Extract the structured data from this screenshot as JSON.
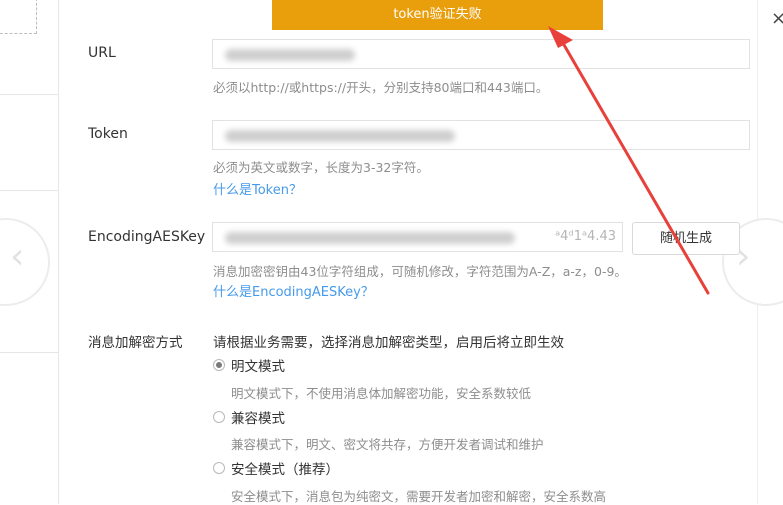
{
  "toast": {
    "message": "token验证失败"
  },
  "url_field": {
    "label": "URL",
    "hint": "必须以http://或https://开头，分别支持80端口和443端口。"
  },
  "token_field": {
    "label": "Token",
    "hint": "必须为英文或数字，长度为3-32字符。",
    "help_link": "什么是Token？"
  },
  "aes_field": {
    "label": "EncodingAESKey",
    "value_visible_suffix": "ᵃ4ᵈ1ᵃ4.43",
    "generate_button": "随机生成",
    "hint": "消息加密密钥由43位字符组成，可随机修改，字符范围为A-Z，a-z，0-9。",
    "help_link": "什么是EncodingAESKey？"
  },
  "encryption": {
    "label": "消息加解密方式",
    "intro": "请根据业务需要，选择消息加解密类型，启用后将立即生效",
    "options": [
      {
        "label": "明文模式",
        "desc": "明文模式下，不使用消息体加解密功能，安全系数较低",
        "checked": true
      },
      {
        "label": "兼容模式",
        "desc": "兼容模式下，明文、密文将共存，方便开发者调试和维护",
        "checked": false
      },
      {
        "label": "安全模式（推荐）",
        "desc": "安全模式下，消息包为纯密文，需要开发者加密和解密，安全系数高",
        "checked": false
      }
    ]
  },
  "colors": {
    "toast_bg": "#e99e0b",
    "link": "#459ae9",
    "arrow": "#e8403a"
  },
  "icons": {
    "carousel_prev": "chevron-left-icon",
    "carousel_next": "chevron-right-icon",
    "close": "close-icon",
    "annotation": "arrow-icon"
  }
}
